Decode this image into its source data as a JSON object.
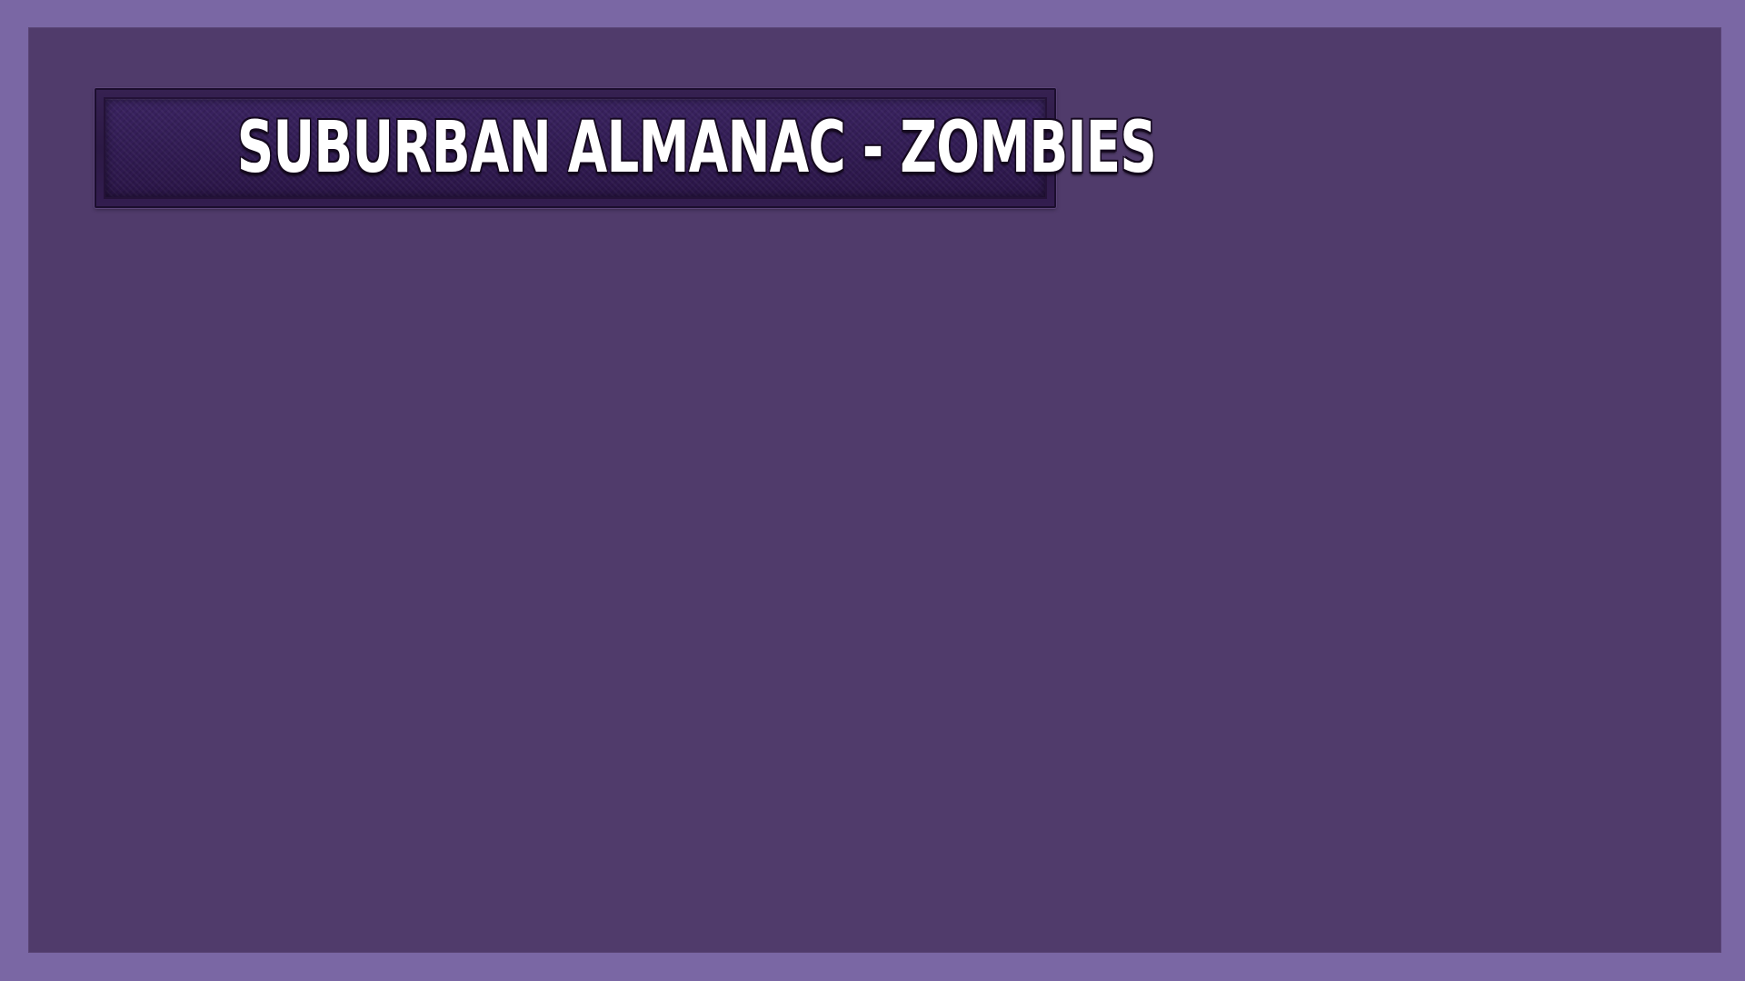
{
  "screen": {
    "title": "SUBURBAN ALMANAC - ZOMBIES"
  },
  "colors": {
    "frame": "#7a67a4",
    "panel": "#503b6b",
    "banner": "#2c1945",
    "title_text": "#ffffff"
  }
}
